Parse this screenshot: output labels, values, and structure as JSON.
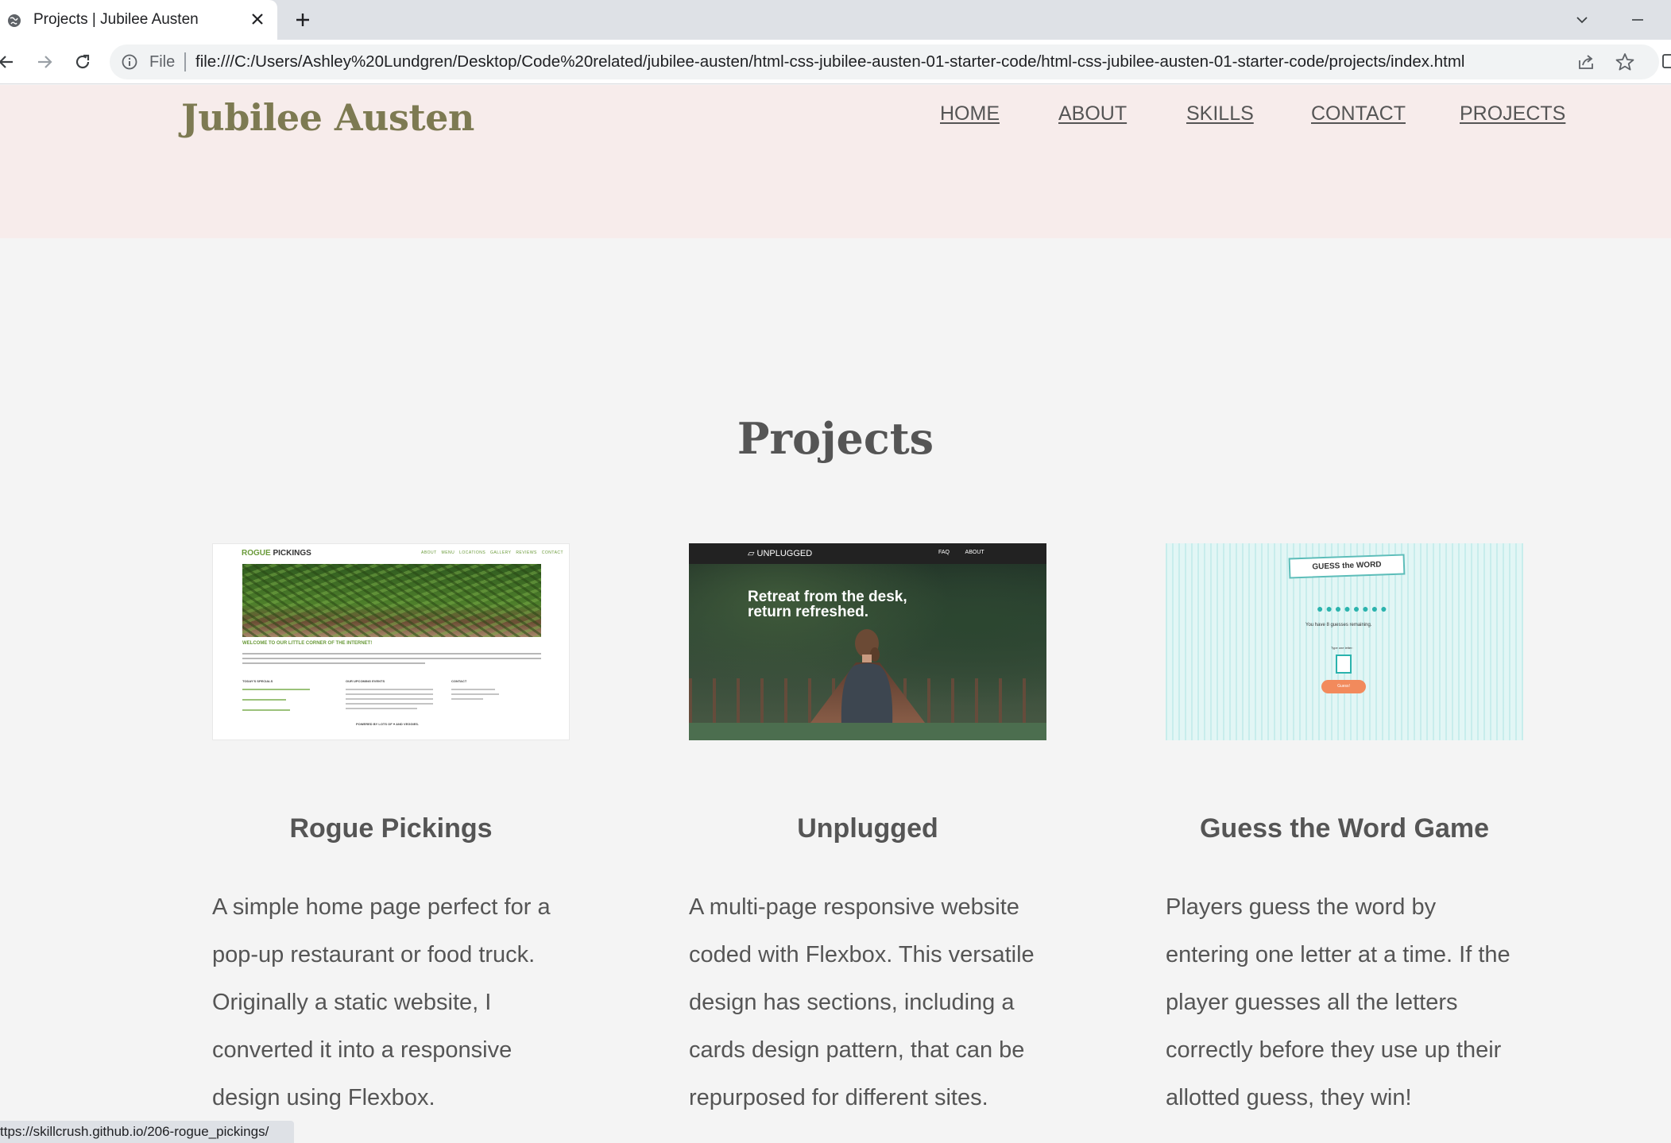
{
  "browser": {
    "tab_title": "Projects | Jubilee Austen",
    "file_label": "File",
    "url": "file:///C:/Users/Ashley%20Lundgren/Desktop/Code%20related/jubilee-austen/html-css-jubilee-austen-01-starter-code/html-css-jubilee-austen-01-starter-code/projects/index.html",
    "status_url": "ttps://skillcrush.github.io/206-rogue_pickings/"
  },
  "site": {
    "logo": "Jubilee Austen",
    "nav": [
      "HOME",
      "ABOUT",
      "SKILLS",
      "CONTACT",
      "PROJECTS"
    ],
    "heading": "Projects"
  },
  "projects": [
    {
      "title": "Rogue Pickings",
      "description": "A simple home page perfect for a pop-up restaurant or food truck. Originally a static website, I converted it into a responsive design using Flexbox.",
      "thumb": {
        "logo_a": "ROGUE",
        "logo_b": "PICKINGS",
        "nav": "ABOUT MENU LOCATIONS GALLERY REVIEWS CONTACT",
        "welcome": "WELCOME TO OUR LITTLE CORNER OF THE INTERNET!",
        "col1": "TODAY'S SPECIALS",
        "col2": "OUR UPCOMING EVENTS",
        "col3": "CONTACT",
        "footer": "POWERED BY LOTS OF ♥ AND VEGGIES."
      }
    },
    {
      "title": "Unplugged",
      "description": "A multi-page responsive website coded with Flexbox. This versatile design has sections, including a cards design pattern, that can be repurposed for different sites.",
      "thumb": {
        "logo": "UNPLUGGED",
        "nav": "FAQ ABOUT",
        "headline_1": "Retreat from the desk,",
        "headline_2": "return refreshed."
      }
    },
    {
      "title": "Guess the Word Game",
      "description": "Players guess the word by entering one letter at a time. If the player guesses all the letters correctly before they use up their allotted guess, they win!",
      "thumb": {
        "title": "GUESS the WORD",
        "dots": "●●●●●●●●",
        "remaining": "You have 8 guesses remaining.",
        "type_label": "Type one letter:",
        "button": "Guess!"
      }
    }
  ],
  "colors": {
    "header_bg": "#f7eceb",
    "logo": "#7d7a52",
    "text": "#555555",
    "page_bg": "#f4f4f4"
  }
}
